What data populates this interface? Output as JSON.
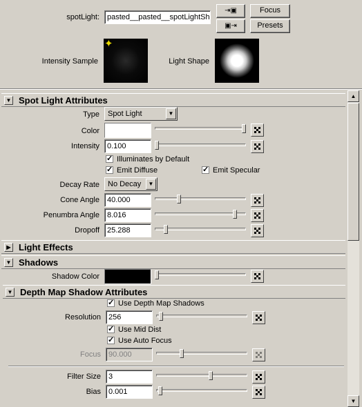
{
  "header": {
    "node_label": "spotLight:",
    "node_name": "pasted__pasted__spotLightSha",
    "focus_label": "Focus",
    "presets_label": "Presets",
    "intensity_sample_label": "Intensity Sample",
    "light_shape_label": "Light Shape"
  },
  "spot_light": {
    "title": "Spot Light Attributes",
    "type_label": "Type",
    "type_value": "Spot Light",
    "color_label": "Color",
    "intensity_label": "Intensity",
    "intensity_value": "0.100",
    "illuminates_default": "Illuminates by Default",
    "emit_diffuse": "Emit Diffuse",
    "emit_specular": "Emit Specular",
    "decay_label": "Decay Rate",
    "decay_value": "No Decay",
    "cone_label": "Cone Angle",
    "cone_value": "40.000",
    "penumbra_label": "Penumbra Angle",
    "penumbra_value": "8.016",
    "dropoff_label": "Dropoff",
    "dropoff_value": "25.288"
  },
  "light_effects": {
    "title": "Light Effects"
  },
  "shadows": {
    "title": "Shadows",
    "shadow_color_label": "Shadow Color"
  },
  "depth_map": {
    "title": "Depth Map Shadow Attributes",
    "use_depth_map": "Use Depth Map Shadows",
    "resolution_label": "Resolution",
    "resolution_value": "256",
    "use_mid_dist": "Use Mid Dist",
    "use_auto_focus": "Use Auto Focus",
    "focus_label": "Focus",
    "focus_value": "90.000",
    "filter_size_label": "Filter Size",
    "filter_size_value": "3",
    "bias_label": "Bias",
    "bias_value": "0.001"
  },
  "sliders": {
    "color": 1.0,
    "intensity": 0.0,
    "cone": 0.25,
    "penumbra": 0.9,
    "dropoff": 0.1,
    "shadow_color": 0.0,
    "resolution": 0.03,
    "focus": 0.27,
    "filter_size": 0.6,
    "bias": 0.02
  },
  "colors": {
    "background": "#d4d0c8",
    "light_color": "#ffffff",
    "shadow_color": "#000000"
  }
}
